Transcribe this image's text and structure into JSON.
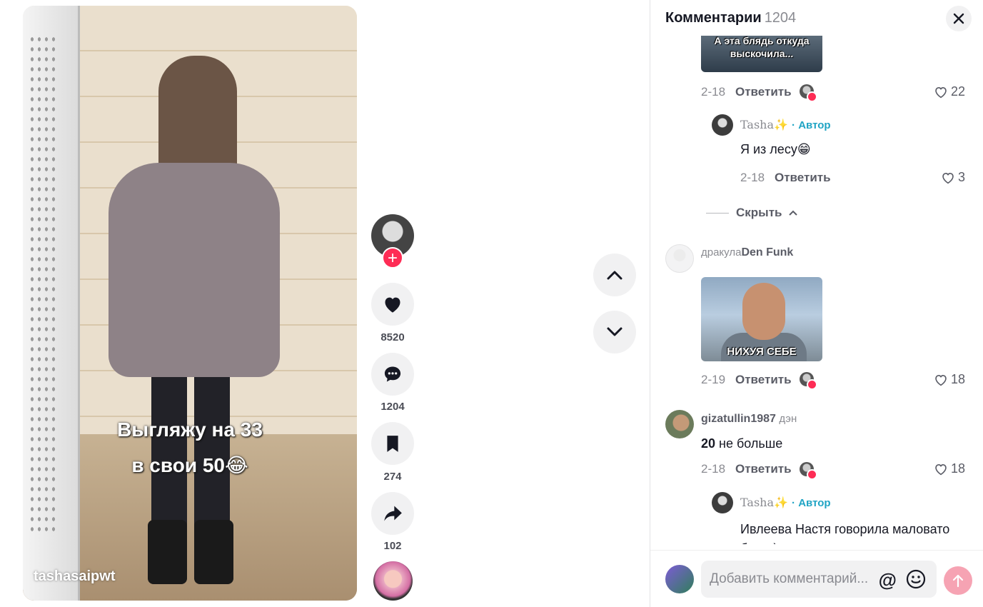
{
  "video": {
    "caption_line1": "Выгляжу на 33",
    "caption_line2": "в свои 50😂",
    "author": "tashasaipwt"
  },
  "actions": {
    "likes": "8520",
    "comments": "1204",
    "saves": "274",
    "shares": "102"
  },
  "comments_panel": {
    "title": "Комментарии",
    "count": "1204",
    "items": [
      {
        "meme_text": "А эта блядь откуда выскочила...",
        "date": "2-18",
        "reply_label": "Ответить",
        "likes": "22"
      },
      {
        "username": "Tasha✨",
        "badge": "· Автор",
        "text": "Я из лесу😁",
        "date": "2-18",
        "reply_label": "Ответить",
        "likes": "3"
      },
      {
        "username": "дракула",
        "username_suffix": "Den Funk",
        "meme_text": "НИХУЯ СЕБЕ",
        "date": "2-19",
        "reply_label": "Ответить",
        "likes": "18"
      },
      {
        "username": "gizatullin1987",
        "username_suffix": "дэн",
        "text_bold": "20",
        "text_rest": " не больше",
        "date": "2-18",
        "reply_label": "Ответить",
        "likes": "18"
      },
      {
        "username": "Tasha✨",
        "badge": "· Автор",
        "text": "Ивлеева Настя говорила маловато будет)"
      }
    ],
    "hide_label": "Скрыть"
  },
  "composer": {
    "placeholder": "Добавить комментарий...",
    "at_symbol": "@"
  },
  "colors": {
    "accent": "#fe2c55",
    "author_badge": "#20a4c4",
    "send_disabled": "#f6a3b3"
  }
}
